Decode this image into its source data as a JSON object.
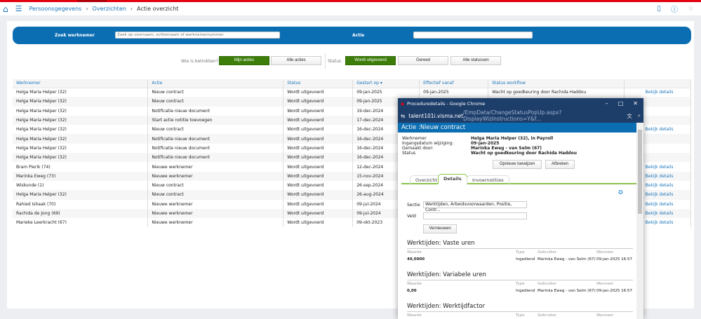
{
  "header": {
    "breadcrumb": [
      "Persoonsgegevens",
      "Overzichten"
    ],
    "current": "Actie overzicht"
  },
  "search": {
    "employee_label": "Zoek werknemer",
    "employee_placeholder": "Zoek op voornaam, achternaam of werknemernummer",
    "action_label": "Actie",
    "action_value": ""
  },
  "filters": {
    "involved_label": "Wie is betrokken?",
    "involved_options": [
      "Mijn acties",
      "Alle acties"
    ],
    "status_label": "Status",
    "status_options": [
      "Wordt uitgevoerd",
      "Gereed",
      "Alle statussen"
    ]
  },
  "table": {
    "columns": [
      "Werknemer",
      "Actie",
      "Status",
      "Gestart op",
      "Effectief vanaf",
      "Status workflow",
      ""
    ],
    "rows": [
      [
        "Helga Maria Helper (32)",
        "Nieuw contract",
        "Wordt uitgevoerd",
        "09-jan-2025",
        "09-jan-2025",
        "Wacht op goedkeuring door Rachida Haddou",
        "Bekijk details"
      ],
      [
        "Helga Maria Helper (32)",
        "Nieuw contract",
        "Wordt uitgevoerd",
        "09-jan-2025",
        "",
        "",
        ""
      ],
      [
        "Helga Maria Helper (32)",
        "Notificatie nieuw document",
        "Wordt uitgevoerd",
        "19-dec-2024",
        "",
        "",
        ""
      ],
      [
        "Helga Maria Helper (32)",
        "Start actie notitie toevoegen",
        "Wordt uitgevoerd",
        "17-dec-2024",
        "",
        "",
        ""
      ],
      [
        "Helga Maria Helper (32)",
        "Nieuw contract",
        "Wordt uitgevoerd",
        "16-dec-2024",
        "",
        "",
        "Bekijk details"
      ],
      [
        "Helga Maria Helper (32)",
        "Notificatie nieuw document",
        "Wordt uitgevoerd",
        "16-dec-2024",
        "",
        "",
        ""
      ],
      [
        "Helga Maria Helper (32)",
        "Notificatie nieuw document",
        "Wordt uitgevoerd",
        "16-dec-2024",
        "",
        "",
        ""
      ],
      [
        "Helga Maria Helper (32)",
        "Notificatie nieuw document",
        "Wordt uitgevoerd",
        "16-dec-2024",
        "",
        "",
        ""
      ],
      [
        "Bram Pierik (74)",
        "Nieuwe werknemer",
        "Wordt uitgevoerd",
        "12-dec-2024",
        "",
        "",
        "Bekijk details"
      ],
      [
        "Marinka Eweg (73)",
        "Nieuwe werknemer",
        "Wordt uitgevoerd",
        "15-nov-2024",
        "",
        "",
        "Bekijk details"
      ],
      [
        "Wiskunde (1)",
        "Nieuw contract",
        "Wordt uitgevoerd",
        "26-sep-2024",
        "",
        "",
        "Bekijk details"
      ],
      [
        "Helga Maria Helper (32)",
        "Nieuw contract",
        "Wordt uitgevoerd",
        "26-aug-2024",
        "",
        "",
        "Bekijk details"
      ],
      [
        "Rahied Ishaak (70)",
        "Nieuwe werknemer",
        "Wordt uitgevoerd",
        "09-jul-2024",
        "",
        "",
        "Bekijk details"
      ],
      [
        "Rachida de Jong (69)",
        "Nieuwe werknemer",
        "Wordt uitgevoerd",
        "09-jul-2024",
        "",
        "",
        "Bekijk details"
      ],
      [
        "Marieke Leerkracht (67)",
        "Nieuwe werknemer",
        "Wordt uitgevoerd",
        "09-okt-2023",
        "",
        "",
        "Bekijk details"
      ]
    ]
  },
  "popup": {
    "window_title": "Proceduredetails - Google Chrome",
    "url_host": "talent101i.visma.net",
    "url_path": "/EmpData/ChangeStatusPopUp.aspx?DisplayWizInstructions=Y&f...",
    "heading": "Actie :Nieuw contract",
    "info": [
      [
        "Werknemer",
        "Helga Maria Helper (32), in Payroll"
      ],
      [
        "Ingangsdatum wijziging:",
        "09-jan-2025"
      ],
      [
        "Gemaakt door:",
        "Marinka Eweg - van Selm (67)"
      ],
      [
        "Status",
        "Wacht op goedkeuring door Rachida Haddou"
      ]
    ],
    "buttons": {
      "reassign": "Opnieuw toewijzen",
      "cancel": "Afbreken",
      "refresh": "Vernieuwen"
    },
    "tabs": [
      "Overzicht",
      "Details",
      "Invoernotities"
    ],
    "section_label": "Sectie",
    "section_value": "Werktijden, Arbeidsvoorwaarden, Positie, Contr...",
    "field_label": "Veld",
    "field_value": "",
    "col_headers": [
      "Waarde",
      "Type",
      "Gebruiker",
      "Wanneer"
    ],
    "sections": [
      {
        "title": "Werktijden: Vaste uren",
        "value": "40,0000",
        "type": "Ingediend",
        "user": "Marinka Eweg - van Selm (67)",
        "when": "09-jan-2025 16:57"
      },
      {
        "title": "Werktijden: Variabele uren",
        "value": "0,00",
        "type": "Ingediend",
        "user": "Marinka Eweg - van Selm (67)",
        "when": "09-jan-2025 16:57"
      },
      {
        "title": "Werktijden: Werktijdfactor"
      }
    ]
  },
  "colors": {
    "brand_blue": "#0c6eb2",
    "active_green": "#3d7d0a",
    "top_red": "#e3000f"
  }
}
